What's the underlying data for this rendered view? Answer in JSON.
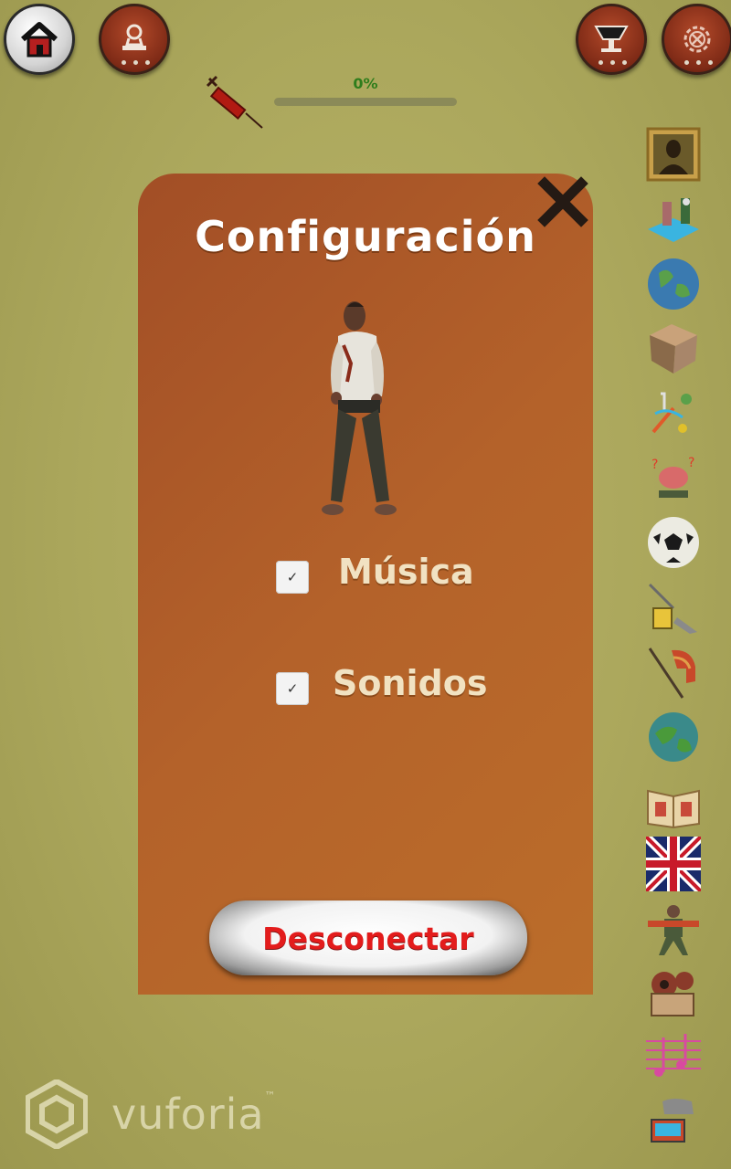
{
  "topbar": {
    "home_icon": "home-icon",
    "profile_icon": "stamp-icon",
    "trophy_icon": "trophy-icon",
    "settings_icon": "gear-icon"
  },
  "progress": {
    "label": "0%",
    "value": 0,
    "syringe_icon": "syringe-icon"
  },
  "settings_panel": {
    "title": "Configuración",
    "close_icon": "close-icon",
    "music": {
      "label": "Música",
      "checked": true
    },
    "sounds": {
      "label": "Sonidos",
      "checked": true
    },
    "disconnect_label": "Desconectar"
  },
  "sidebar": {
    "items": [
      "mona-lisa-painting-icon",
      "science-lab-icon",
      "globe-icon",
      "photo-cube-icon",
      "music-notes-icon",
      "brain-question-icon",
      "soccer-ball-icon",
      "chemistry-icon",
      "spartan-helmet-icon",
      "earth-icon",
      "picture-book-icon",
      "uk-flag-icon",
      "soldier-icon",
      "projector-icon",
      "music-staff-icon",
      "computer-games-icon"
    ]
  },
  "watermark": {
    "brand": "vuforia",
    "tm": "™"
  },
  "colors": {
    "background": "#aba75c",
    "panel": "#b15d29",
    "progress_green": "#2f7d1c",
    "disconnect_red": "#e31c1c"
  }
}
